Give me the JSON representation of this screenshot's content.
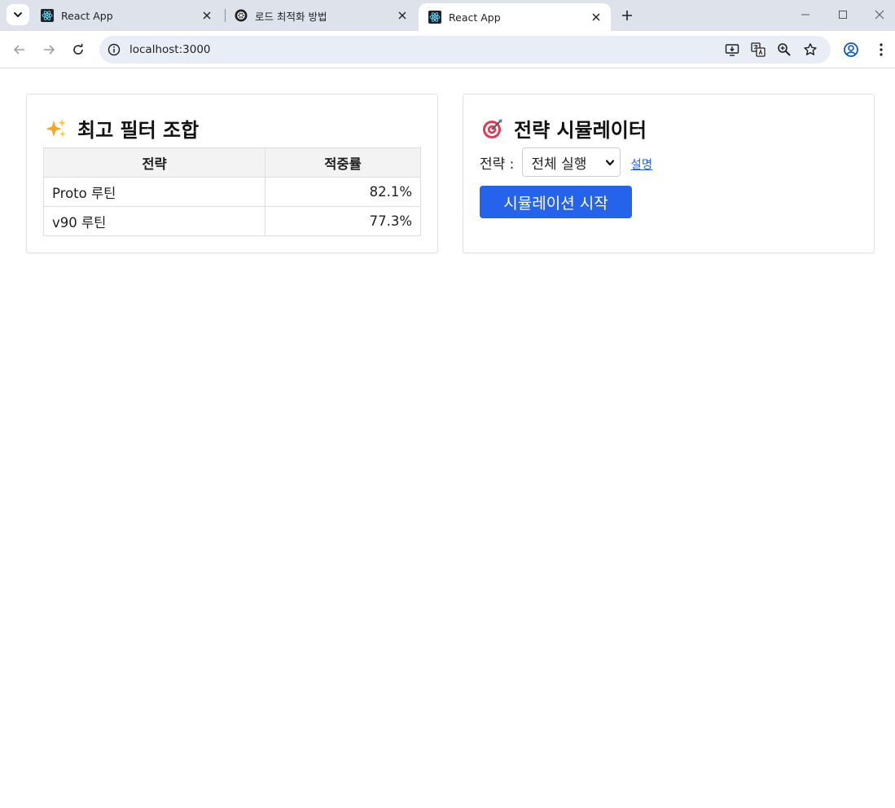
{
  "browser": {
    "tabs": [
      {
        "title": "React App",
        "favicon": "react-icon",
        "active": false
      },
      {
        "title": "로드 최적화 방법",
        "favicon": "openai-icon",
        "active": false
      },
      {
        "title": "React App",
        "favicon": "react-icon",
        "active": true
      }
    ],
    "url": "localhost:3000"
  },
  "filter_card": {
    "title": "최고 필터 조합",
    "emoji": "sparkles-icon",
    "columns": [
      "전략",
      "적중률"
    ],
    "rows": [
      {
        "strategy": "Proto 루틴",
        "hit_rate": "82.1%"
      },
      {
        "strategy": "v90 루틴",
        "hit_rate": "77.3%"
      }
    ]
  },
  "simulator_card": {
    "title": "전략 시뮬레이터",
    "emoji": "target-icon",
    "strategy_label": "전략 :",
    "strategy_selected": "전체 실행",
    "help_link": "설명",
    "start_button": "시뮬레이션 시작"
  },
  "colors": {
    "accent": "#2563eb",
    "tabstrip": "#dee3eb",
    "omnibox": "#e9eef6"
  }
}
